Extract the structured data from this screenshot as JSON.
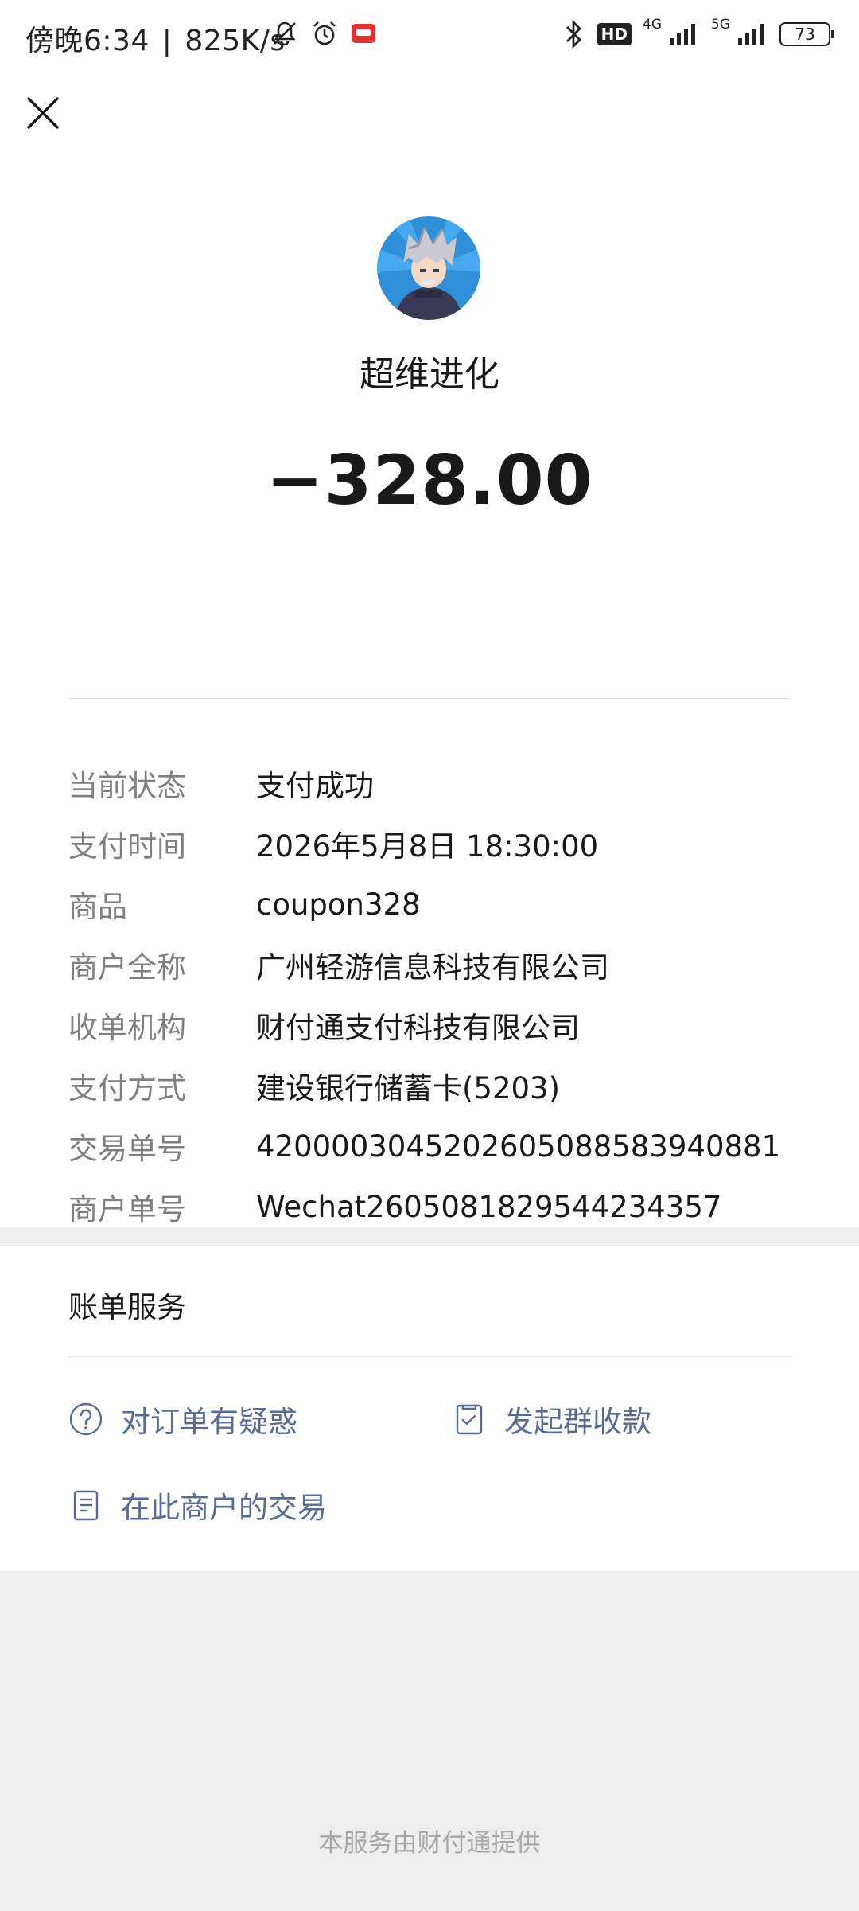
{
  "status_bar": {
    "time": "傍晚6:34",
    "separator": "|",
    "speed": "825K/s",
    "network_4g": "4G",
    "network_5g": "5G",
    "hd_badge": "HD",
    "battery": "73"
  },
  "header": {
    "merchant_name": "超维进化",
    "amount": "−328.00"
  },
  "details": [
    {
      "label": "当前状态",
      "value": "支付成功"
    },
    {
      "label": "支付时间",
      "value": "2026年5月8日 18:30:00"
    },
    {
      "label": "商品",
      "value": "coupon328"
    },
    {
      "label": "商户全称",
      "value": "广州轻游信息科技有限公司"
    },
    {
      "label": "收单机构",
      "value": "财付通支付科技有限公司"
    },
    {
      "label": "支付方式",
      "value": "建设银行储蓄卡(5203)"
    },
    {
      "label": "交易单号",
      "value": "4200003045202605088583940881"
    },
    {
      "label": "商户单号",
      "value": "Wechat2605081829544234357"
    }
  ],
  "services": {
    "title": "账单服务",
    "order_question": "对订单有疑惑",
    "group_collect": "发起群收款",
    "merchant_transactions": "在此商户的交易"
  },
  "footer": {
    "provider_note": "本服务由财付通提供"
  },
  "colors": {
    "link": "#576b95",
    "label_gray": "#7f7f7f",
    "text_dark": "#191919",
    "background": "#ededed"
  },
  "icons": {
    "close": "close-icon",
    "question": "question-circle-icon",
    "group_collect": "receipt-check-icon",
    "transactions": "document-list-icon"
  }
}
